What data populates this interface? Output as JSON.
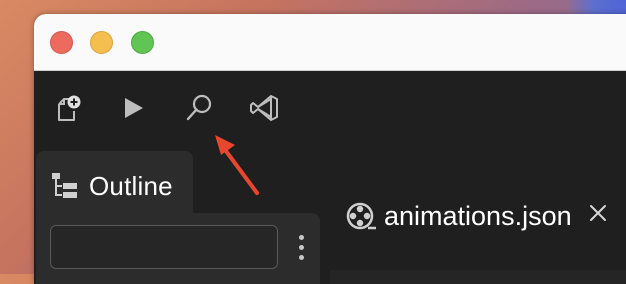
{
  "window": {
    "controls": [
      "close",
      "minimize",
      "zoom"
    ]
  },
  "toolbar": {
    "buttons": [
      {
        "icon": "new-file-icon"
      },
      {
        "icon": "run-icon"
      },
      {
        "icon": "search-icon"
      },
      {
        "icon": "vscode-icon"
      }
    ]
  },
  "outline": {
    "tab_label": "Outline",
    "filter_value": "",
    "filter_placeholder": ""
  },
  "editor": {
    "active_tab": {
      "name": "animations.json",
      "icon": "film-reel-icon"
    }
  },
  "annotation": {
    "arrow_color": "#e8472e"
  }
}
